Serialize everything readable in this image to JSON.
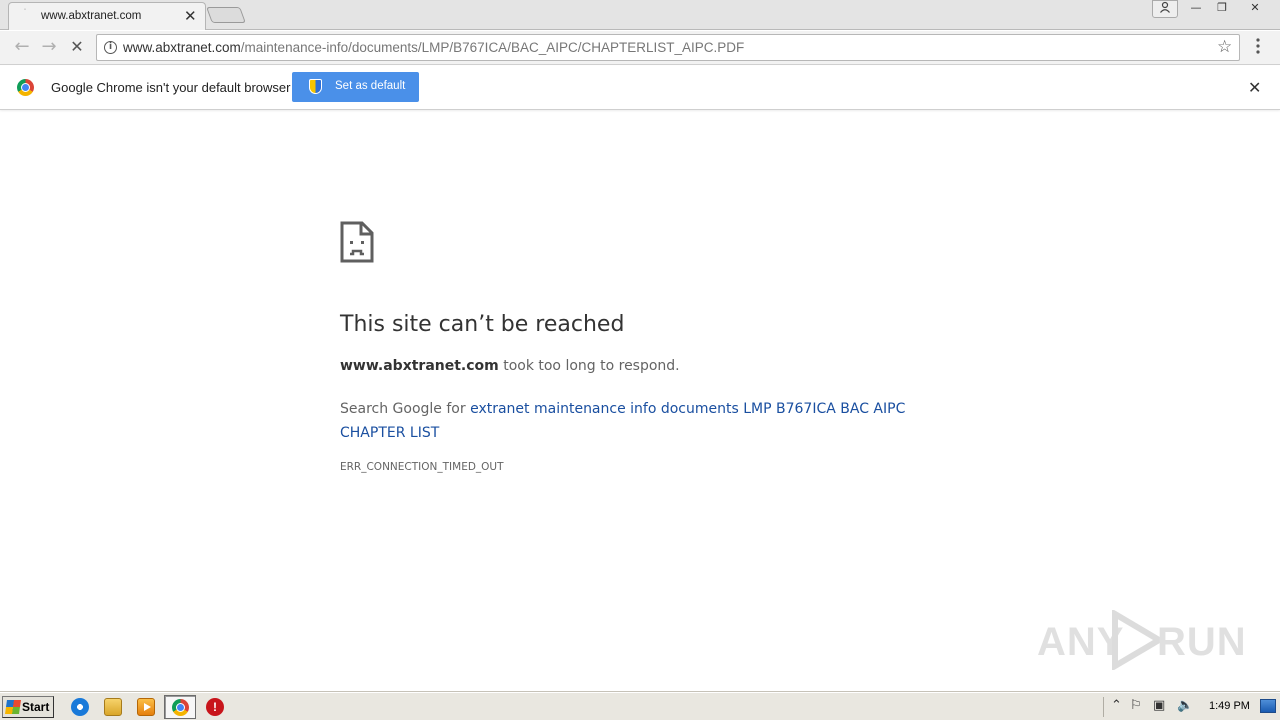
{
  "tab": {
    "title": "www.abxtranet.com",
    "close": "✕"
  },
  "toolbar": {
    "back": "←",
    "forward": "→",
    "stop": "✕",
    "url_host": "www.abxtranet.com",
    "url_path": "/maintenance-info/documents/LMP/B767ICA/BAC_AIPC/CHAPTERLIST_AIPC.PDF",
    "star": "☆",
    "menu": "⋮"
  },
  "infobar": {
    "message": "Google Chrome isn't your default browser",
    "button_label": "Set as default",
    "close": "✕"
  },
  "error": {
    "title": "This site can’t be reached",
    "host": "www.abxtranet.com",
    "detail": " took too long to respond.",
    "search_prefix": "Search Google for ",
    "search_link": "extranet maintenance info documents LMP B767ICA BAC AIPC CHAPTER LIST",
    "code": "ERR_CONNECTION_TIMED_OUT"
  },
  "watermark": {
    "left": "ANY",
    "right": "RUN"
  },
  "taskbar": {
    "start_label": "Start",
    "clock": "1:49 PM",
    "stop_icon_glyph": "!"
  },
  "window_controls": {
    "minimize": "—",
    "maximize": "❐",
    "close": "✕",
    "user": "👤"
  },
  "colors": {
    "link": "#1a4fa0",
    "default_button": "#4a90e9"
  }
}
